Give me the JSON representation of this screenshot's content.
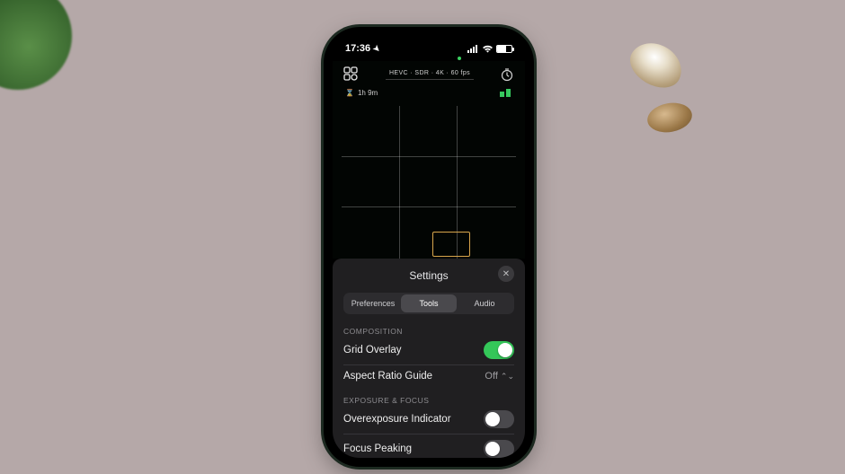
{
  "status": {
    "time": "17:36",
    "battery_pct": 60
  },
  "viewfinder": {
    "format_line": "HEVC · SDR · 4K · 60 fps",
    "record_remaining": "1h 9m"
  },
  "sheet": {
    "title": "Settings",
    "tabs": [
      {
        "label": "Preferences",
        "selected": false
      },
      {
        "label": "Tools",
        "selected": true
      },
      {
        "label": "Audio",
        "selected": false
      }
    ],
    "sections": [
      {
        "header": "COMPOSITION",
        "rows": [
          {
            "label": "Grid Overlay",
            "type": "switch",
            "on": true
          },
          {
            "label": "Aspect Ratio Guide",
            "type": "value",
            "value": "Off"
          }
        ]
      },
      {
        "header": "EXPOSURE & FOCUS",
        "rows": [
          {
            "label": "Overexposure Indicator",
            "type": "switch",
            "on": false
          },
          {
            "label": "Focus Peaking",
            "type": "switch",
            "on": false
          }
        ]
      }
    ]
  }
}
